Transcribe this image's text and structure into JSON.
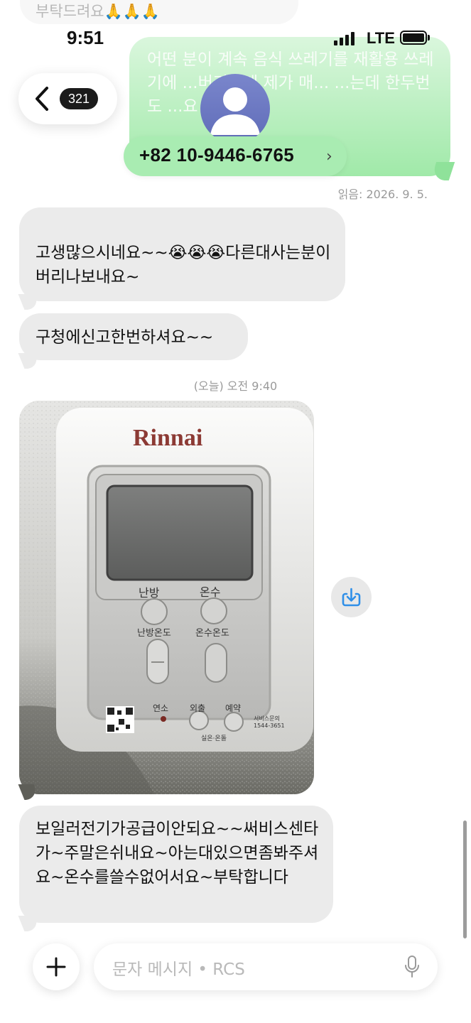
{
  "status_bar": {
    "time": "9:51",
    "network": "LTE"
  },
  "header": {
    "back_badge": "321",
    "contact_phone": "+82 10-9446-6765",
    "chevron": "›"
  },
  "top_partial_message": "부탁드려요🙏🙏🙏",
  "sent_message": {
    "text": "어떤 분이 계속 음식 쓰레기를 재활용 쓰레기에 ...버리는데 제가 매... ...는데 한두번도 ...요",
    "read_receipt": "읽음: 2026. 9. 5."
  },
  "messages": [
    {
      "text": "고생많으시네요~~😭😭😭다른대사는분이버리나보내요~"
    },
    {
      "text": "구청에신고한번하셔요~~"
    }
  ],
  "timestamp": "(오늘) 오전 9:40",
  "photo": {
    "brand": "Rinnai",
    "btn_heating": "난방",
    "btn_hot_water": "온수",
    "label_heating_temp": "난방온도",
    "label_water_temp": "온수온도",
    "label_combustion": "연소",
    "label_away": "외출",
    "label_reserve": "예약",
    "label_indoor_water": "실온·온돌",
    "service_label": "서비스문의",
    "service_phone": "1544-3651"
  },
  "last_message": {
    "text": "보일러전기가공급이안되요~~써비스센타가~주말은쉬내요~아는대있으면좀봐주셔요~온수를쓸수없어서요~부탁합니다"
  },
  "composer": {
    "placeholder": "문자 메시지 • RCS"
  },
  "icons": [
    "back-chevron-icon",
    "person-avatar-icon",
    "download-icon",
    "plus-icon",
    "mic-icon"
  ],
  "colors": {
    "sent_bubble": "#9be8a4",
    "received_bubble": "#ebebeb",
    "phone_pill": "#a9ecb2",
    "download_icon": "#2f8fe8"
  }
}
